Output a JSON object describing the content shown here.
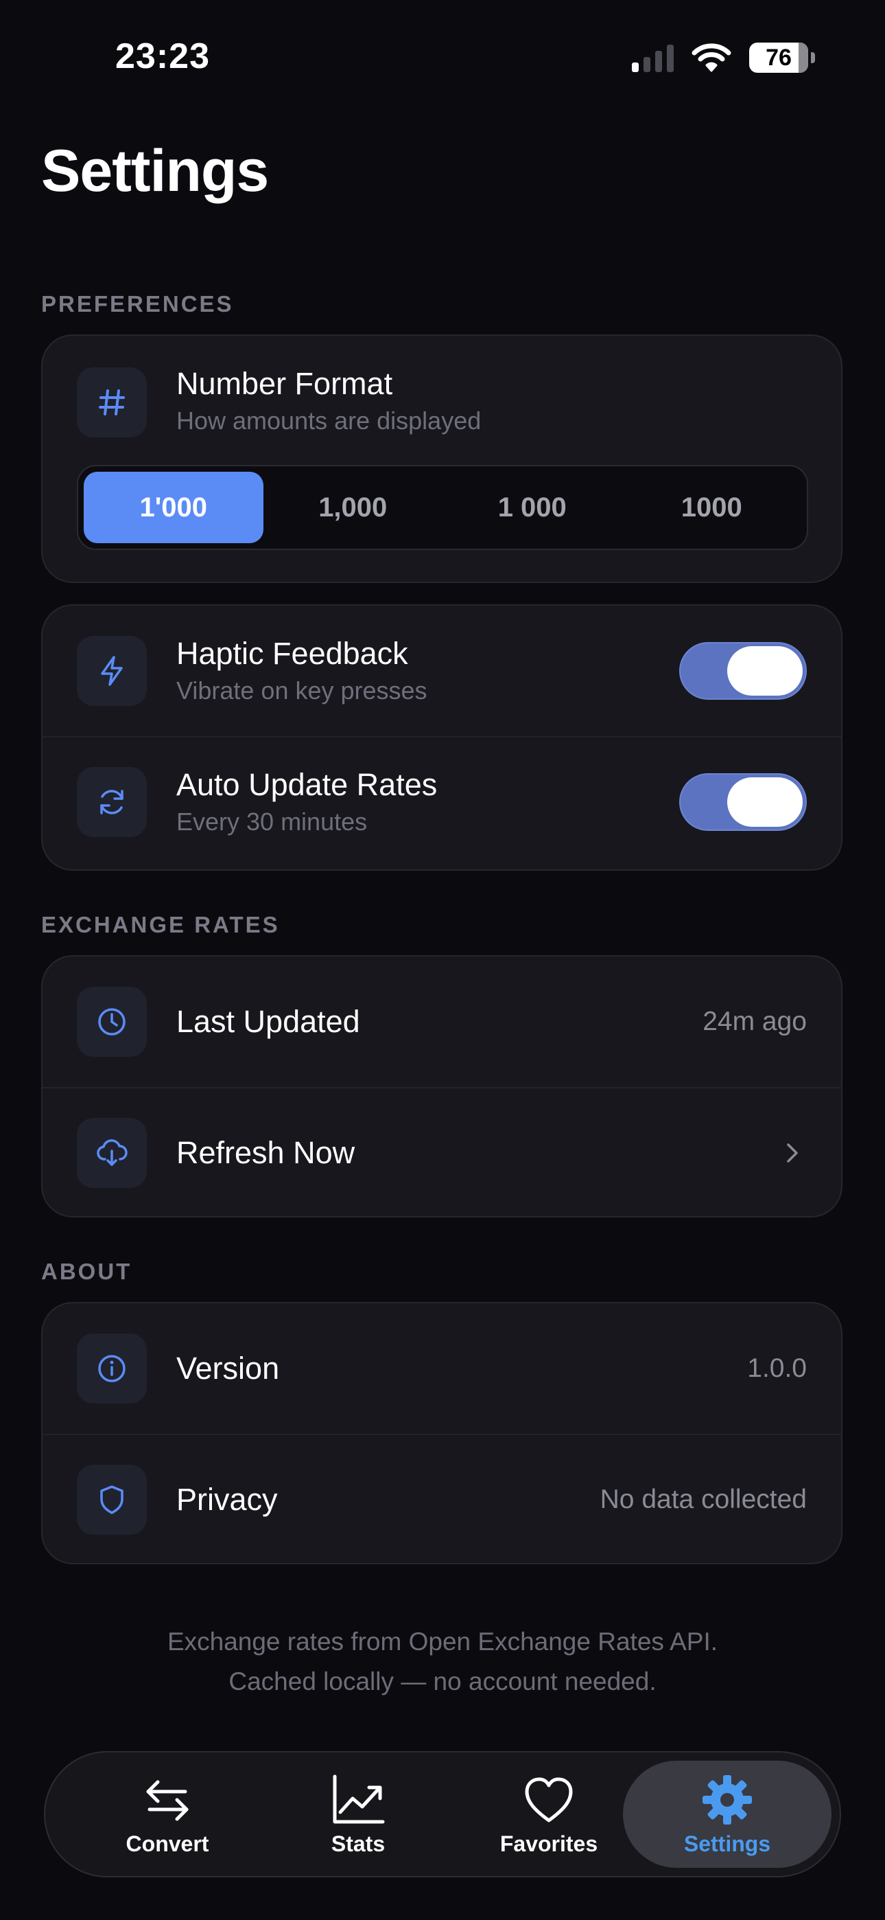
{
  "status_bar": {
    "time": "23:23",
    "battery": "76"
  },
  "page": {
    "title": "Settings"
  },
  "sections": {
    "preferences": "PREFERENCES",
    "exchange_rates": "EXCHANGE RATES",
    "about": "ABOUT"
  },
  "number_format": {
    "title": "Number Format",
    "subtitle": "How amounts are displayed",
    "icon": "hash-icon",
    "options": [
      "1'000",
      "1,000",
      "1 000",
      "1000"
    ],
    "selected": "1'000"
  },
  "toggles": {
    "haptic": {
      "title": "Haptic Feedback",
      "subtitle": "Vibrate on key presses",
      "icon": "lightning-icon",
      "on": true
    },
    "auto_update": {
      "title": "Auto Update Rates",
      "subtitle": "Every 30 minutes",
      "icon": "refresh-icon",
      "on": true
    }
  },
  "exchange": {
    "last_updated": {
      "title": "Last Updated",
      "value": "24m ago",
      "icon": "clock-icon"
    },
    "refresh": {
      "title": "Refresh Now",
      "icon": "cloud-download-icon"
    }
  },
  "about": {
    "version": {
      "title": "Version",
      "value": "1.0.0",
      "icon": "info-icon"
    },
    "privacy": {
      "title": "Privacy",
      "value": "No data collected",
      "icon": "shield-icon"
    }
  },
  "footer": {
    "line1": "Exchange rates from Open Exchange Rates API.",
    "line2": "Cached locally — no account needed."
  },
  "tabbar": {
    "convert": "Convert",
    "stats": "Stats",
    "favorites": "Favorites",
    "settings": "Settings",
    "active": "settings"
  },
  "colors": {
    "accent": "#5b8cf6",
    "toggle_on": "#5b73c0",
    "active_tab_label": "#4a9bf0",
    "background": "#0b0b0f",
    "card": "#17171d"
  }
}
